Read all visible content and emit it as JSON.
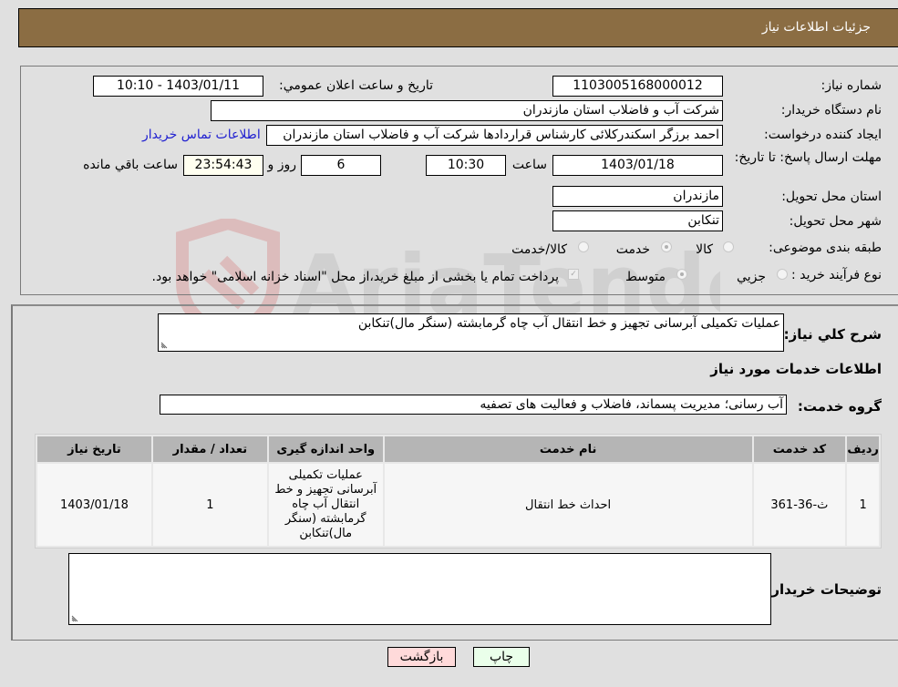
{
  "header": {
    "title": "جزئیات اطلاعات نیاز"
  },
  "form": {
    "need_number": {
      "label": "شماره نیاز:",
      "value": "1103005168000012"
    },
    "announce_datetime": {
      "label": "تاريخ و ساعت اعلان عمومي:",
      "value": "1403/01/11 - 10:10"
    },
    "buyer_org": {
      "label": "نام دستگاه خريدار:",
      "value": "شرکت آب و فاضلاب استان مازندران"
    },
    "requester": {
      "label": "ايجاد کننده درخواست:",
      "value": "احمد برزگر اسکندرکلائی کارشناس قراردادها شرکت آب و فاضلاب استان مازندران",
      "contact_link": "اطلاعات تماس خريدار"
    },
    "deadline": {
      "label": "مهلت ارسال پاسخ: تا تاريخ:",
      "date": "1403/01/18",
      "time_label": "ساعت",
      "time": "10:30",
      "days": "6",
      "days_label": "روز و",
      "remaining": "23:54:43",
      "remaining_label": "ساعت باقي مانده"
    },
    "province": {
      "label": "استان محل تحويل:",
      "value": "مازندران"
    },
    "city": {
      "label": "شهر محل تحويل:",
      "value": "تنکابن"
    },
    "category": {
      "label": "طبقه بندی موضوعی:",
      "options": [
        "کالا",
        "خدمت",
        "کالا/خدمت"
      ],
      "selected": "خدمت"
    },
    "purchase_process": {
      "label": "نوع فرآيند خريد :",
      "options": [
        "جزيي",
        "متوسط"
      ],
      "selected": "متوسط",
      "treasury_note": "پرداخت تمام يا بخشی از مبلغ خريد،از محل \"اسناد خزانه اسلامی\" خواهد بود.",
      "treasury_checked": true
    }
  },
  "details": {
    "general_desc_label": "شرح کلي نياز:",
    "general_desc": "عمليات تکميلی آبرسانی تجهيز و خط انتقال آب چاه گرمابشته (سنگر مال)تنکابن",
    "services_heading": "اطلاعات خدمات مورد نياز",
    "service_group_label": "گروه خدمت:",
    "service_group": "آب رسانی؛ مديريت پسماند، فاضلاب و فعاليت های تصفيه",
    "table": {
      "headers": [
        "رديف",
        "کد خدمت",
        "نام خدمت",
        "واحد اندازه گيری",
        "تعداد / مقدار",
        "تاريخ نياز"
      ],
      "rows": [
        [
          "1",
          "ث-36-361",
          "احداث خط انتقال",
          "عمليات تکميلی آبرسانی تجهيز و خط انتقال آب چاه گرمابشته (سنگر مال)تنکابن",
          "1",
          "1403/01/18"
        ]
      ]
    },
    "buyer_notes_label": "توضيحات خريدار:",
    "buyer_notes": ""
  },
  "buttons": {
    "print": "چاپ",
    "back": "بازگشت"
  },
  "colors": {
    "header_bg": "#8b6d43",
    "print_bg": "#eaffea",
    "back_bg": "#ffdada",
    "link": "#2020d0"
  },
  "watermark": {
    "text": "AriaTender.neT"
  }
}
